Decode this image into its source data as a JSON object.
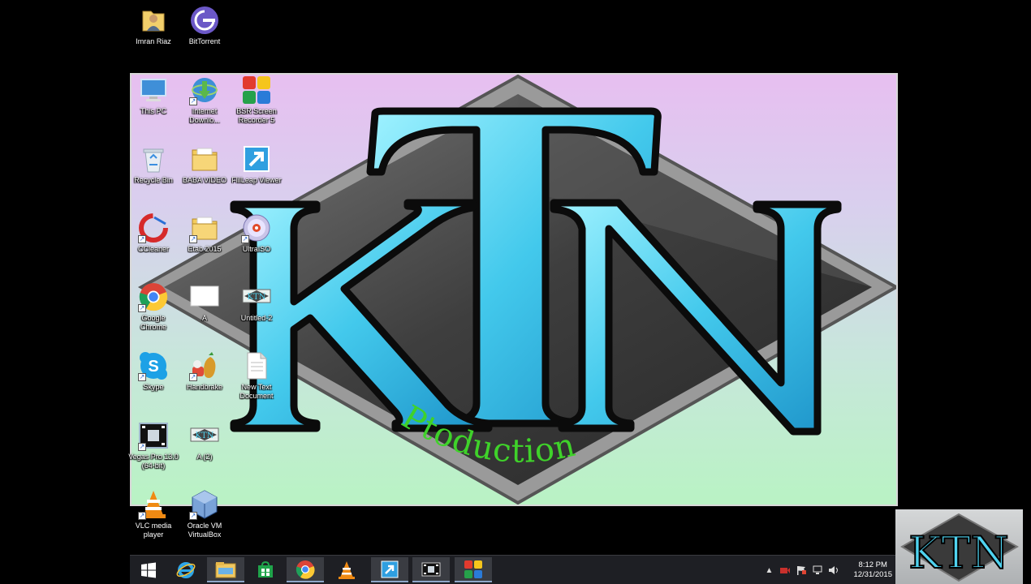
{
  "desktop": {
    "top_icons": [
      {
        "label": "Imran Riaz",
        "icon": "folder-user-icon"
      },
      {
        "label": "BitTorrent",
        "icon": "bittorrent-icon"
      }
    ],
    "icons": [
      {
        "label": "This PC",
        "icon": "computer-icon"
      },
      {
        "label": "Internet Downlo...",
        "icon": "internet-download-manager-icon"
      },
      {
        "label": "BSR Screen Recorder 5",
        "icon": "bsr-screen-recorder-icon"
      },
      {
        "label": "Recycle Bin",
        "icon": "recycle-bin-icon"
      },
      {
        "label": "BABA VIDEO",
        "icon": "folder-icon"
      },
      {
        "label": "FlilLeap Viewer",
        "icon": "shortcut-icon"
      },
      {
        "label": "CCleaner",
        "icon": "ccleaner-icon"
      },
      {
        "label": "Etab 2015",
        "icon": "folder-icon"
      },
      {
        "label": "UltraISO",
        "icon": "ultraiso-disc-icon"
      },
      {
        "label": "Google Chrome",
        "icon": "chrome-icon"
      },
      {
        "label": "A",
        "icon": "blank-file-icon"
      },
      {
        "label": "Untitled-2",
        "icon": "image-file-icon"
      },
      {
        "label": "Skype",
        "icon": "skype-icon"
      },
      {
        "label": "Handbrake",
        "icon": "handbrake-icon"
      },
      {
        "label": "New Text Document",
        "icon": "text-document-icon"
      },
      {
        "label": "Vegas Pro 13.0 (64-bit)",
        "icon": "vegas-pro-icon"
      },
      {
        "label": "A (2)",
        "icon": "image-file-icon"
      },
      {
        "label": "VLC media player",
        "icon": "vlc-icon"
      },
      {
        "label": "Oracle VM VirtualBox",
        "icon": "virtualbox-icon"
      }
    ]
  },
  "wallpaper": {
    "logo_text": "KTN",
    "subtitle": "Ptoduction"
  },
  "taskbar": {
    "items": [
      {
        "name": "start-button",
        "icon": "windows-logo-icon"
      },
      {
        "name": "internet-explorer",
        "icon": "internet-explorer-icon"
      },
      {
        "name": "file-explorer",
        "icon": "file-explorer-icon"
      },
      {
        "name": "windows-store",
        "icon": "store-icon"
      },
      {
        "name": "google-chrome",
        "icon": "chrome-icon"
      },
      {
        "name": "vlc",
        "icon": "vlc-icon"
      },
      {
        "name": "shortcut-app",
        "icon": "shortcut-icon"
      },
      {
        "name": "vegas-pro",
        "icon": "vegas-pro-icon"
      },
      {
        "name": "bsr-screen-recorder",
        "icon": "bsr-screen-recorder-icon"
      }
    ],
    "clock": {
      "time": "8:12 PM",
      "date": "12/31/2015"
    }
  },
  "watermark": {
    "text": "KTN"
  },
  "colors": {
    "accent_cyan": "#5fd8f2",
    "production_green": "#3fd22a",
    "taskbar": "#1e1f24"
  }
}
